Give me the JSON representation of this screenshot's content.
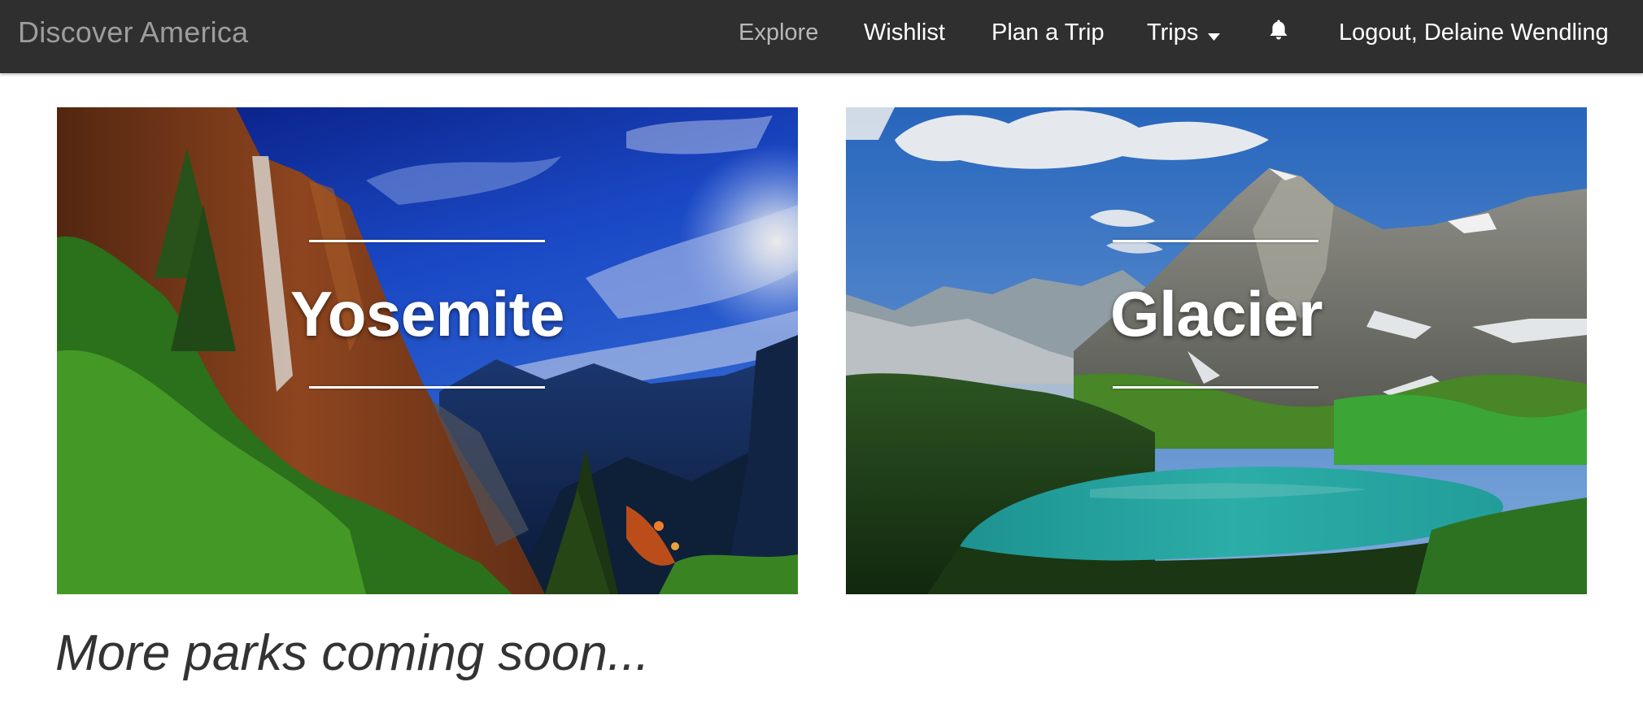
{
  "navbar": {
    "brand": "Discover America",
    "items": [
      {
        "label": "Explore",
        "active": true
      },
      {
        "label": "Wishlist"
      },
      {
        "label": "Plan a Trip"
      },
      {
        "label": "Trips",
        "icon": "caret-down-icon"
      },
      {
        "icon": "bell-icon"
      },
      {
        "label": "Logout, Delaine Wendling"
      }
    ],
    "background_color": "#2f2f2f",
    "active_color": "#b8b8b8"
  },
  "parks": [
    {
      "name": "Yosemite"
    },
    {
      "name": "Glacier"
    }
  ],
  "footer_note": "More parks coming soon..."
}
